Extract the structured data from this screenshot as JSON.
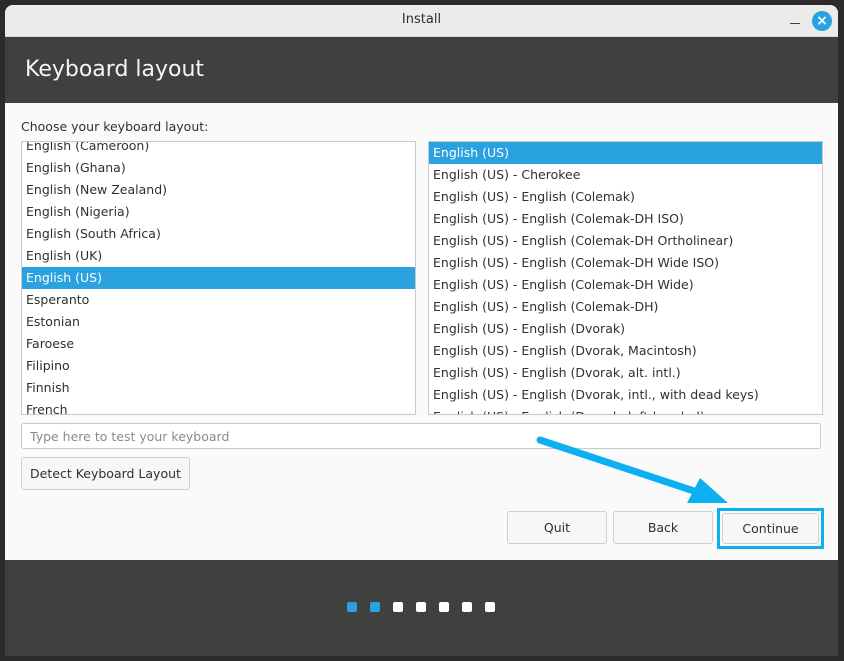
{
  "window": {
    "title": "Install",
    "close_icon": "×"
  },
  "header": {
    "title": "Keyboard layout"
  },
  "main": {
    "choose_label": "Choose your keyboard layout:",
    "layouts": [
      "English (Cameroon)",
      "English (Ghana)",
      "English (New Zealand)",
      "English (Nigeria)",
      "English (South Africa)",
      "English (UK)",
      "English (US)",
      "Esperanto",
      "Estonian",
      "Faroese",
      "Filipino",
      "Finnish",
      "French"
    ],
    "selected_layout": "English (US)",
    "variants": [
      "English (US)",
      "English (US) - Cherokee",
      "English (US) - English (Colemak)",
      "English (US) - English (Colemak-DH ISO)",
      "English (US) - English (Colemak-DH Ortholinear)",
      "English (US) - English (Colemak-DH Wide ISO)",
      "English (US) - English (Colemak-DH Wide)",
      "English (US) - English (Colemak-DH)",
      "English (US) - English (Dvorak)",
      "English (US) - English (Dvorak, Macintosh)",
      "English (US) - English (Dvorak, alt. intl.)",
      "English (US) - English (Dvorak, intl., with dead keys)",
      "English (US) - English (Dvorak, left-handed)"
    ],
    "selected_variant": "English (US)",
    "test_placeholder": "Type here to test your keyboard",
    "test_value": "",
    "detect_label": "Detect Keyboard Layout"
  },
  "buttons": {
    "quit": "Quit",
    "back": "Back",
    "continue": "Continue"
  },
  "progress": {
    "total_steps": 7,
    "completed_steps": 2
  },
  "colors": {
    "accent": "#2aa2e0",
    "highlight_annotation": "#0ab0ef",
    "header_bg": "#404040"
  },
  "icons": {
    "close": "close-icon",
    "minimize": "minimize-icon",
    "annotation_arrow": "arrow-icon"
  }
}
